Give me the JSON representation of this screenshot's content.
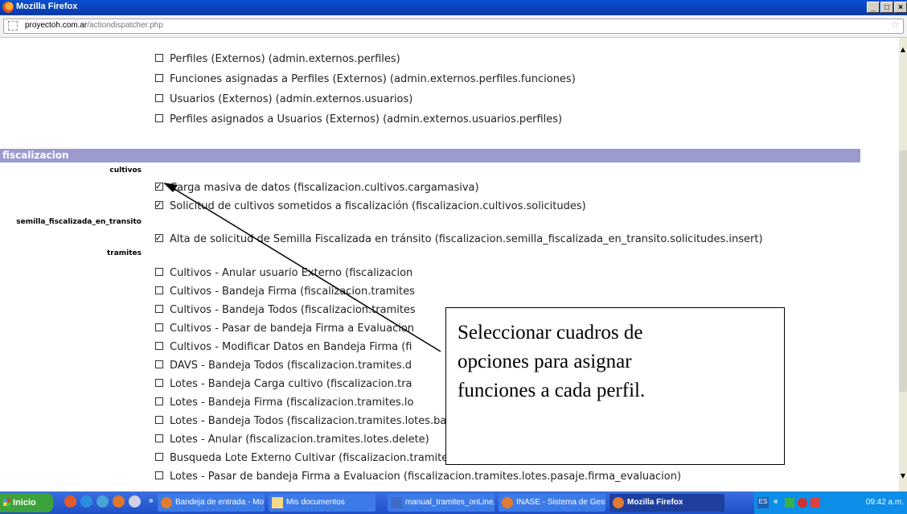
{
  "window": {
    "title": "Mozilla Firefox",
    "buttons": [
      "_",
      "□",
      "×"
    ]
  },
  "urlbar": {
    "domain": "proyectoh.com.ar",
    "path": "/actiondispatcher.php"
  },
  "top_options": [
    "Perfiles (Externos) (admin.externos.perfiles)",
    "Funciones asignadas a Perfiles (Externos) (admin.externos.perfiles.funciones)",
    "Usuarios (Externos) (admin.externos.usuarios)",
    "Perfiles asignados a Usuarios (Externos) (admin.externos.usuarios.perfiles)"
  ],
  "section": {
    "title": "fiscalizacion"
  },
  "groups": {
    "cultivos": "cultivos",
    "semilla": "semilla_fiscalizada_en_transito",
    "tramites": "tramites"
  },
  "cultivos_options": [
    {
      "label": "Carga masiva de datos (fiscalizacion.cultivos.cargamasiva)",
      "checked": true
    },
    {
      "label": "Solicitud de cultivos sometidos a fiscalización (fiscalizacion.cultivos.solicitudes)",
      "checked": true
    }
  ],
  "semilla_options": [
    {
      "label": "Alta de solicitud de Semilla Fiscalizada en tránsito (fiscalizacion.semilla_fiscalizada_en_transito.solicitudes.insert)",
      "checked": true
    }
  ],
  "tramites_options": [
    {
      "label": "Cultivos - Anular usuario Externo (fiscalizacion",
      "checked": false
    },
    {
      "label": "Cultivos - Bandeja Firma (fiscalizacion.tramites",
      "checked": false
    },
    {
      "label": "Cultivos - Bandeja Todos (fiscalizacion.tramites",
      "checked": false
    },
    {
      "label": "Cultivos - Pasar de bandeja Firma a Evaluacion",
      "checked": false
    },
    {
      "label": "Cultivos - Modificar Datos en Bandeja Firma (fi",
      "checked": false
    },
    {
      "label": "DAVS - Bandeja Todos (fiscalizacion.tramites.d",
      "checked": false
    },
    {
      "label": "Lotes - Bandeja Carga cultivo (fiscalizacion.tra",
      "checked": false
    },
    {
      "label": "Lotes - Bandeja Firma (fiscalizacion.tramites.lo",
      "checked": false
    },
    {
      "label": "Lotes - Bandeja Todos (fiscalizacion.tramites.lotes.bandejas.todos)",
      "checked": false
    },
    {
      "label": "Lotes - Anular (fiscalizacion.tramites.lotes.delete)",
      "checked": false
    },
    {
      "label": "Busqueda Lote Externo Cultivar (fiscalizacion.tramites.lotes.listado.externos)",
      "checked": false
    },
    {
      "label": "Lotes - Pasar de bandeja Firma a Evaluacion (fiscalizacion.tramites.lotes.pasaje.firma_evaluacion)",
      "checked": false
    }
  ],
  "callout": {
    "lines": [
      "Seleccionar cuadros de",
      "opciones para asignar",
      "funciones a cada perfil."
    ]
  },
  "taskbar": {
    "start": "Inicio",
    "overflow": "»",
    "tasks": [
      "Bandeja de entrada - Mo...",
      "Mis documentos",
      "manual_tramites_onLine...",
      "INASE - Sistema de Gesti...",
      "Mozilla Firefox"
    ],
    "lang": "ES",
    "tray_chevron": "«",
    "clock": "09:42 a.m."
  }
}
